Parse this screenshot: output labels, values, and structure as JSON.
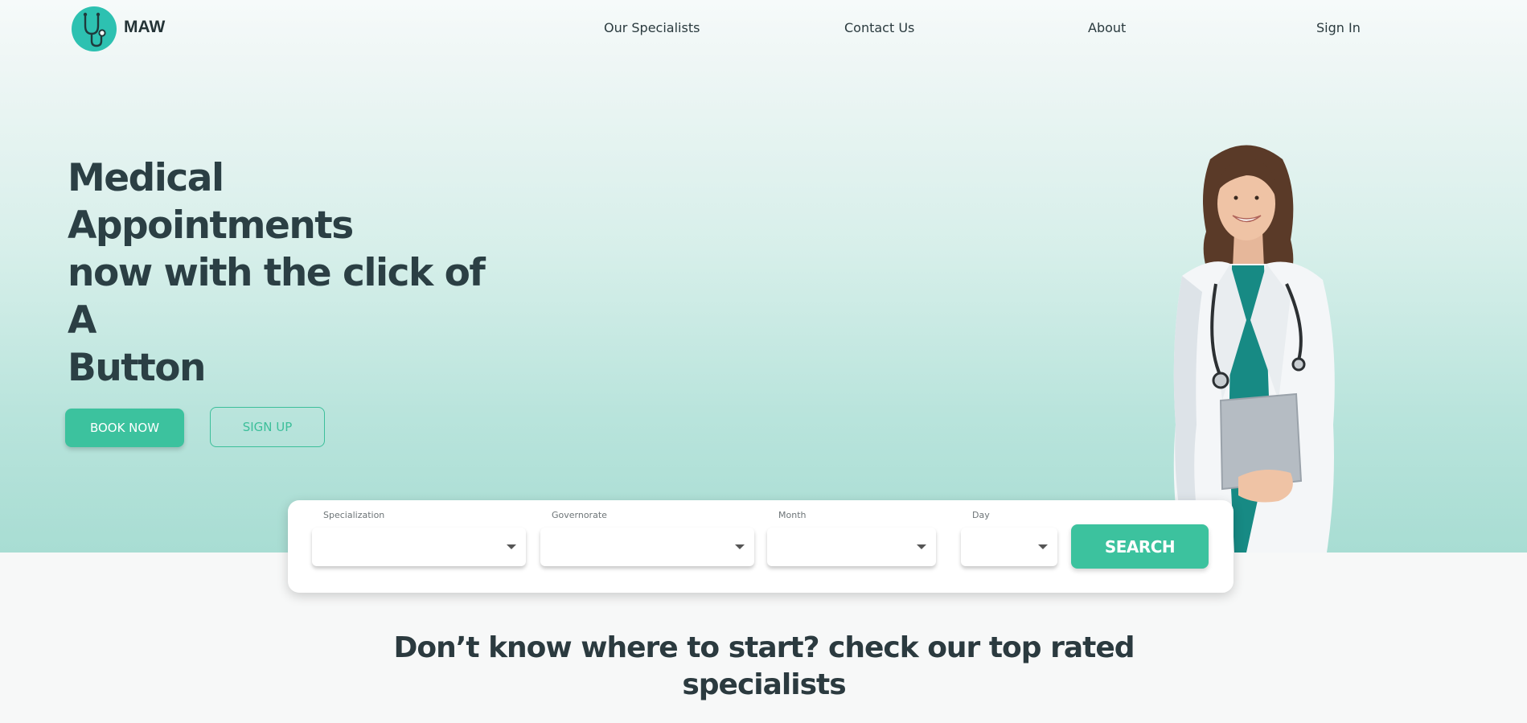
{
  "brand": {
    "name": "MAW"
  },
  "nav": {
    "links": [
      "Our Specialists",
      "Contact Us",
      "About",
      "Sign In"
    ]
  },
  "hero": {
    "title_lines": [
      "Medical Appointments",
      "now with the click of A",
      "Button"
    ],
    "book_label": "BOOK NOW",
    "signup_label": "SIGN UP"
  },
  "search": {
    "fields": [
      {
        "label": "Specialization",
        "value": ""
      },
      {
        "label": "Governorate",
        "value": ""
      },
      {
        "label": "Month",
        "value": ""
      },
      {
        "label": "Day",
        "value": ""
      }
    ],
    "button_label": "SEARCH"
  },
  "section": {
    "title_lines": [
      "Don’t know where to start? check our top rated",
      "specialists"
    ]
  },
  "colors": {
    "accent": "#3cc29e",
    "logo": "#2dc1b1",
    "text_dark": "#2b3f44"
  },
  "icons": {
    "logo": "stethoscope-icon",
    "dropdown": "caret-down-icon"
  }
}
